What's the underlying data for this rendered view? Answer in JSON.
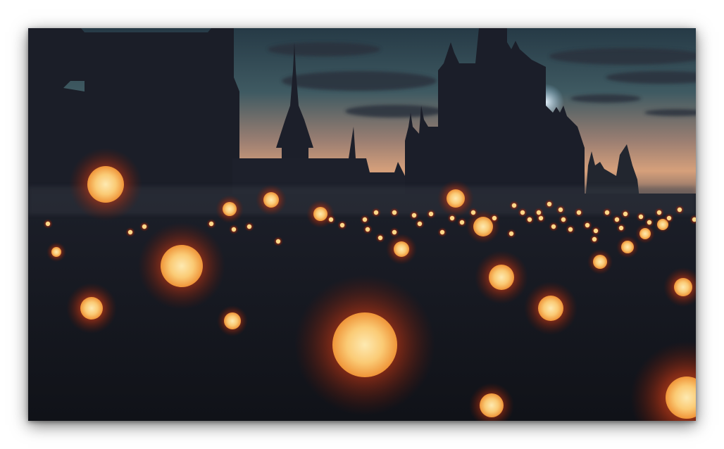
{
  "photo": {
    "subject": "castle-silhouette-with-lanterns",
    "colors": {
      "sky_top": "#2f4552",
      "sky_horizon": "#d2a07c",
      "silhouette": "#1a1d26",
      "ground": "#15171f",
      "lantern_core": "#ffd98a",
      "lantern_glow": "#ff5a1e"
    }
  }
}
